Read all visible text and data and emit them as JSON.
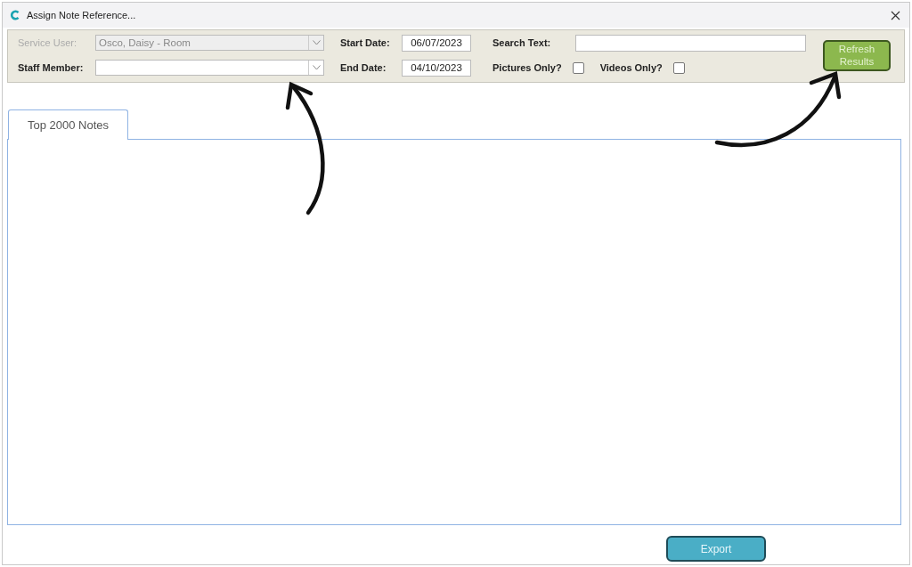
{
  "window": {
    "title": "Assign Note Reference..."
  },
  "filters": {
    "service_user": {
      "label": "Service User:",
      "value": "Osco, Daisy - Room",
      "disabled": true
    },
    "staff_member": {
      "label": "Staff Member:",
      "disabled": false
    },
    "start_date": {
      "label": "Start Date:",
      "value": "06/07/2023"
    },
    "end_date": {
      "label": "End Date:",
      "value": "04/10/2023"
    },
    "search_text": {
      "label": "Search Text:"
    },
    "checkboxes": [
      {
        "label": "Pictures Only?",
        "checked": false
      },
      {
        "label": "Videos Only?",
        "checked": false
      }
    ],
    "refresh_button": "Refresh Results"
  },
  "tabs": [
    {
      "label": "Top 2000 Notes",
      "selected": true
    }
  ],
  "buttons": [
    "Export"
  ]
}
